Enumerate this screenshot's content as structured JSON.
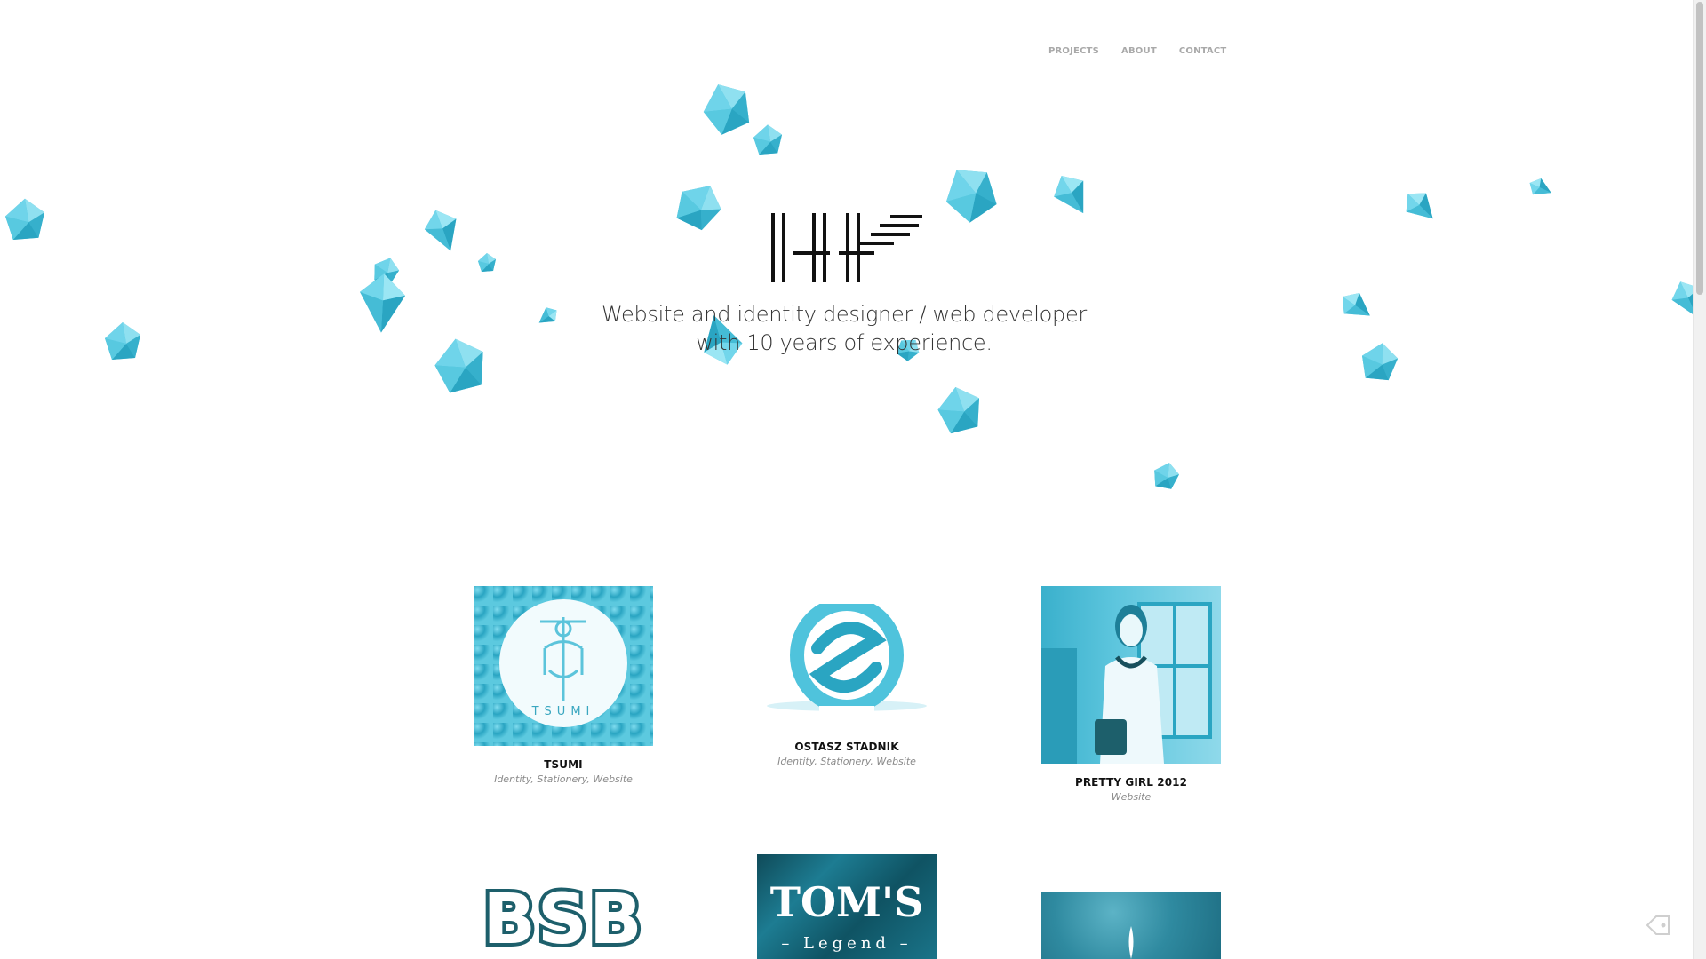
{
  "nav": {
    "projects": "PROJECTS",
    "about": "ABOUT",
    "contact": "CONTACT"
  },
  "hero": {
    "logo_text": "HF",
    "tagline_line1": "Website and identity designer / web developer",
    "tagline_line2": "with 10 years of experience."
  },
  "projects": [
    {
      "title": "TSUMI",
      "tags": "Identity, Stationery, Website",
      "thumb_text": "TSUMI"
    },
    {
      "title": "OSTASZ STADNIK",
      "tags": "Identity, Stationery, Website"
    },
    {
      "title": "PRETTY GIRL 2012",
      "tags": "Website"
    },
    {
      "title": "",
      "tags": "",
      "thumb_text": "BSB"
    },
    {
      "title": "",
      "tags": "",
      "thumb_text_line1": "TOM'S",
      "thumb_text_line2": "– Legend –"
    },
    {
      "title": "",
      "tags": ""
    }
  ],
  "colors": {
    "crystal": "#4fc3dc",
    "crystal_dark": "#2aa5c2",
    "crystal_light": "#8fe0f0",
    "accent_teal": "#1d5f6b",
    "nav_text": "#a9a9a9"
  },
  "icons": {
    "corner": "tag-icon"
  }
}
